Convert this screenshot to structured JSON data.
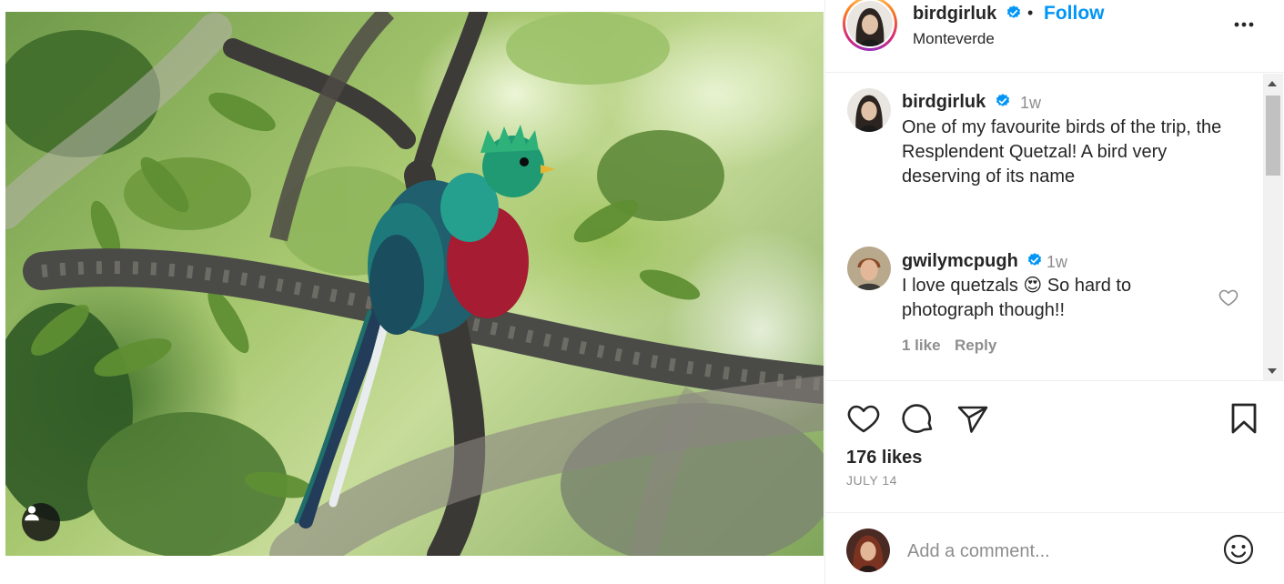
{
  "post": {
    "author": "birdgirluk",
    "follow_label": "Follow",
    "separator": "•",
    "location": "Monteverde",
    "likes": "176 likes",
    "date": "JULY 14"
  },
  "comments": [
    {
      "user": "birdgirluk",
      "time": "1w",
      "text": "One of my favourite birds of the trip, the Resplendent Quetzal! A bird very deserving of its name"
    },
    {
      "user": "gwilymcpugh",
      "time": "1w",
      "text": "I love quetzals 😍 So hard to photograph though!!",
      "likes_label": "1 like",
      "reply_label": "Reply"
    }
  ],
  "composer": {
    "placeholder": "Add a comment..."
  },
  "colors": {
    "accent": "#0095f6",
    "verified": "#0095f6",
    "muted": "#8e8e8e"
  },
  "icons": [
    "user-tag-icon",
    "verified-icon",
    "more-icon",
    "heart-icon",
    "comment-icon",
    "share-icon",
    "bookmark-icon",
    "emoji-icon"
  ]
}
